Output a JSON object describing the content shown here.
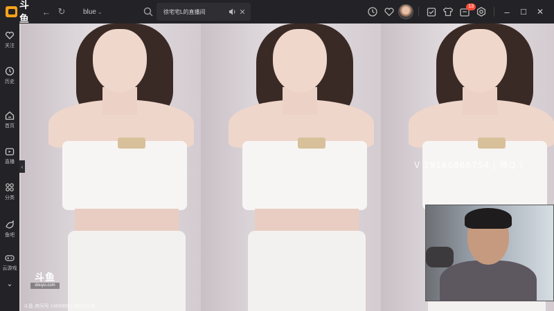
{
  "app": {
    "logo_text": "斗鱼"
  },
  "nav": {
    "back": "←",
    "refresh": "↻"
  },
  "search": {
    "value": "blue",
    "suffix_glyph": "⌄"
  },
  "tab": {
    "title": "徐宅宅L的直播间",
    "close": "✕"
  },
  "toolbar": {
    "notification_count": "13",
    "minimize": "–",
    "maximize": "☐",
    "close": "✕"
  },
  "sidebar": {
    "items": [
      {
        "label": "关注",
        "icon": "heart-icon"
      },
      {
        "label": "历史",
        "icon": "clock-icon"
      },
      {
        "label": "首页",
        "icon": "home-icon"
      },
      {
        "label": "直播",
        "icon": "live-tv-icon"
      },
      {
        "label": "分类",
        "icon": "grid-icon"
      },
      {
        "label": "鱼吧",
        "icon": "fish-icon"
      },
      {
        "label": "云游戏",
        "icon": "gamepad-icon"
      }
    ],
    "more": "⌄",
    "collapse": "‹"
  },
  "watermark": {
    "contact": "V 19166866754 | 微Q )",
    "logo_top": "斗鱼",
    "logo_sub": "douyu.com",
    "room_info": "斗鱼 房间号 1466969 | 2023/2/28"
  },
  "colors": {
    "accent": "#f7a21b",
    "badge": "#ff4d3a",
    "chrome": "#232327"
  }
}
